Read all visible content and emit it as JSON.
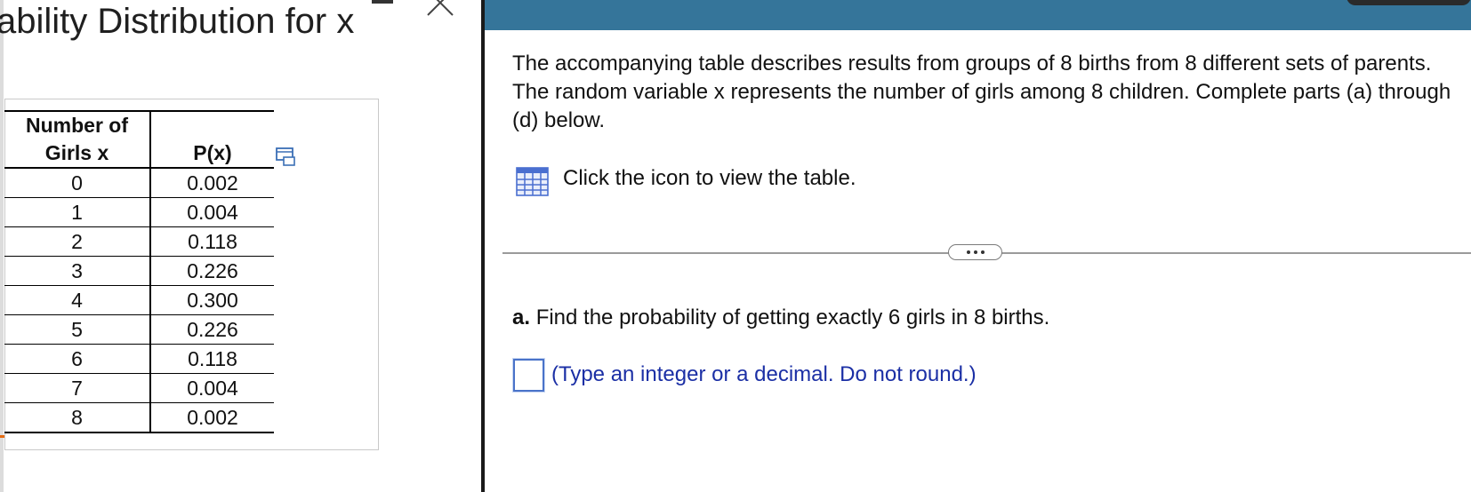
{
  "popup": {
    "title": "ability Distribution for x",
    "table": {
      "headers": [
        "Number of Girls x",
        "P(x)"
      ],
      "rows": [
        [
          "0",
          "0.002"
        ],
        [
          "1",
          "0.004"
        ],
        [
          "2",
          "0.118"
        ],
        [
          "3",
          "0.226"
        ],
        [
          "4",
          "0.300"
        ],
        [
          "5",
          "0.226"
        ],
        [
          "6",
          "0.118"
        ],
        [
          "7",
          "0.004"
        ],
        [
          "8",
          "0.002"
        ]
      ]
    },
    "icons": {
      "minimize": "minimize-icon",
      "close": "close-icon",
      "copy": "copy-table-icon"
    }
  },
  "question": {
    "intro": "The accompanying table describes results from groups of 8 births from 8 different sets of parents. The random variable x represents the number of girls among 8 children. Complete parts (a) through (d) below.",
    "table_link_text": "Click the icon to view the table.",
    "part_label": "a.",
    "part_text": "Find the probability of getting exactly 6 girls in 8 births.",
    "answer_value": "",
    "answer_hint": "(Type an integer or a decimal. Do not round.)"
  },
  "colors": {
    "header_bar": "#35759a",
    "hint_text": "#1b2fa5",
    "input_border": "#4a73c9"
  }
}
